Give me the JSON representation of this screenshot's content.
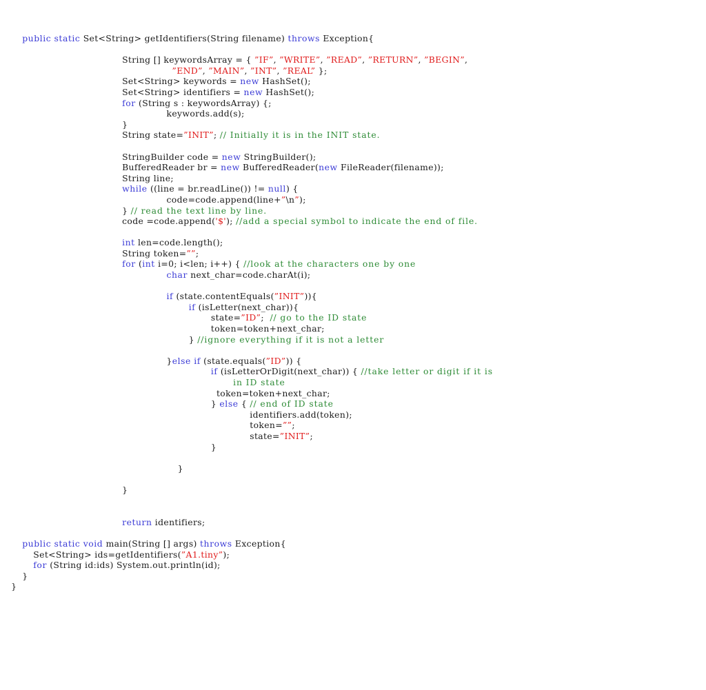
{
  "document": {
    "kind": "code-listing",
    "language": "Java",
    "theme": {
      "background": "#ffffff",
      "plain": "#1a1a1a",
      "keyword": "#3b3bd6",
      "string": "#e01b1b",
      "comment": "#2e8b36"
    }
  },
  "lines": [
    {
      "indent": 4,
      "tokens": [
        {
          "t": "kw",
          "s": "public"
        },
        {
          "t": "pln",
          "s": " "
        },
        {
          "t": "kw",
          "s": "static"
        },
        {
          "t": "pln",
          "s": " Set<String> getIdentifiers(String filename) "
        },
        {
          "t": "kw",
          "s": "throws"
        },
        {
          "t": "pln",
          "s": " Exception{"
        }
      ]
    },
    {
      "indent": 0,
      "tokens": []
    },
    {
      "indent": 22,
      "tokens": [
        {
          "t": "pln",
          "s": "String [] keywordsArray = { "
        },
        {
          "t": "str",
          "s": "”IF”"
        },
        {
          "t": "pln",
          "s": ", "
        },
        {
          "t": "str",
          "s": "”WRITE”"
        },
        {
          "t": "pln",
          "s": ", "
        },
        {
          "t": "str",
          "s": "”READ”"
        },
        {
          "t": "pln",
          "s": ", "
        },
        {
          "t": "str",
          "s": "”RETURN”"
        },
        {
          "t": "pln",
          "s": ", "
        },
        {
          "t": "str",
          "s": "”BEGIN”"
        },
        {
          "t": "pln",
          "s": ","
        }
      ]
    },
    {
      "indent": 31,
      "tokens": [
        {
          "t": "str",
          "s": "”END”"
        },
        {
          "t": "pln",
          "s": ", "
        },
        {
          "t": "str",
          "s": "”MAIN”"
        },
        {
          "t": "pln",
          "s": ", "
        },
        {
          "t": "str",
          "s": "”INT”"
        },
        {
          "t": "pln",
          "s": ", "
        },
        {
          "t": "str",
          "s": "”REAL”"
        },
        {
          "t": "pln",
          "s": " };"
        }
      ]
    },
    {
      "indent": 22,
      "tokens": [
        {
          "t": "pln",
          "s": "Set<String> keywords = "
        },
        {
          "t": "kw",
          "s": "new"
        },
        {
          "t": "pln",
          "s": " HashSet();"
        }
      ]
    },
    {
      "indent": 22,
      "tokens": [
        {
          "t": "pln",
          "s": "Set<String> identifiers = "
        },
        {
          "t": "kw",
          "s": "new"
        },
        {
          "t": "pln",
          "s": " HashSet();"
        }
      ]
    },
    {
      "indent": 22,
      "tokens": [
        {
          "t": "kw",
          "s": "for"
        },
        {
          "t": "pln",
          "s": " (String s : keywordsArray) {;"
        }
      ]
    },
    {
      "indent": 30,
      "tokens": [
        {
          "t": "pln",
          "s": "keywords.add(s);"
        }
      ]
    },
    {
      "indent": 22,
      "tokens": [
        {
          "t": "pln",
          "s": "}"
        }
      ]
    },
    {
      "indent": 22,
      "tokens": [
        {
          "t": "pln",
          "s": "String state="
        },
        {
          "t": "str",
          "s": "”INIT”"
        },
        {
          "t": "pln",
          "s": "; "
        },
        {
          "t": "cmt",
          "s": "// Initially it is in the INIT state."
        }
      ]
    },
    {
      "indent": 0,
      "tokens": []
    },
    {
      "indent": 22,
      "tokens": [
        {
          "t": "pln",
          "s": "StringBuilder code = "
        },
        {
          "t": "kw",
          "s": "new"
        },
        {
          "t": "pln",
          "s": " StringBuilder();"
        }
      ]
    },
    {
      "indent": 22,
      "tokens": [
        {
          "t": "pln",
          "s": "BufferedReader br = "
        },
        {
          "t": "kw",
          "s": "new"
        },
        {
          "t": "pln",
          "s": " BufferedReader("
        },
        {
          "t": "kw",
          "s": "new"
        },
        {
          "t": "pln",
          "s": " FileReader(filename));"
        }
      ]
    },
    {
      "indent": 22,
      "tokens": [
        {
          "t": "pln",
          "s": "String line;"
        }
      ]
    },
    {
      "indent": 22,
      "tokens": [
        {
          "t": "kw",
          "s": "while"
        },
        {
          "t": "pln",
          "s": " ((line = br.readLine()) != "
        },
        {
          "t": "kw",
          "s": "null"
        },
        {
          "t": "pln",
          "s": ") {"
        }
      ]
    },
    {
      "indent": 30,
      "tokens": [
        {
          "t": "pln",
          "s": "code=code.append(line+"
        },
        {
          "t": "str",
          "s": "”"
        },
        {
          "t": "pln",
          "s": "\\n"
        },
        {
          "t": "str",
          "s": "”"
        },
        {
          "t": "pln",
          "s": ");"
        }
      ]
    },
    {
      "indent": 22,
      "tokens": [
        {
          "t": "pln",
          "s": "} "
        },
        {
          "t": "cmt",
          "s": "// read the text line by line."
        }
      ]
    },
    {
      "indent": 22,
      "tokens": [
        {
          "t": "pln",
          "s": "code =code.append("
        },
        {
          "t": "str",
          "s": "'$'"
        },
        {
          "t": "pln",
          "s": "); "
        },
        {
          "t": "cmt",
          "s": "//add a special symbol to indicate the end of file."
        }
      ]
    },
    {
      "indent": 0,
      "tokens": []
    },
    {
      "indent": 22,
      "tokens": [
        {
          "t": "kw",
          "s": "int"
        },
        {
          "t": "pln",
          "s": " len=code.length();"
        }
      ]
    },
    {
      "indent": 22,
      "tokens": [
        {
          "t": "pln",
          "s": "String token="
        },
        {
          "t": "str",
          "s": "””"
        },
        {
          "t": "pln",
          "s": ";"
        }
      ]
    },
    {
      "indent": 22,
      "tokens": [
        {
          "t": "kw",
          "s": "for"
        },
        {
          "t": "pln",
          "s": " ("
        },
        {
          "t": "kw",
          "s": "int"
        },
        {
          "t": "pln",
          "s": " i=0; i<len; i++) { "
        },
        {
          "t": "cmt",
          "s": "//look at the characters one by one"
        }
      ]
    },
    {
      "indent": 30,
      "tokens": [
        {
          "t": "kw",
          "s": "char"
        },
        {
          "t": "pln",
          "s": " next_char=code.charAt(i);"
        }
      ]
    },
    {
      "indent": 0,
      "tokens": []
    },
    {
      "indent": 30,
      "tokens": [
        {
          "t": "kw",
          "s": "if"
        },
        {
          "t": "pln",
          "s": " (state.contentEquals("
        },
        {
          "t": "str",
          "s": "”INIT”"
        },
        {
          "t": "pln",
          "s": ")){"
        }
      ]
    },
    {
      "indent": 34,
      "tokens": [
        {
          "t": "kw",
          "s": "if"
        },
        {
          "t": "pln",
          "s": " (isLetter(next_char)){"
        }
      ]
    },
    {
      "indent": 38,
      "tokens": [
        {
          "t": "pln",
          "s": "state="
        },
        {
          "t": "str",
          "s": "”ID”"
        },
        {
          "t": "pln",
          "s": ";  "
        },
        {
          "t": "cmt",
          "s": "// go to the ID state"
        }
      ]
    },
    {
      "indent": 38,
      "tokens": [
        {
          "t": "pln",
          "s": "token=token+next_char;"
        }
      ]
    },
    {
      "indent": 34,
      "tokens": [
        {
          "t": "pln",
          "s": "} "
        },
        {
          "t": "cmt",
          "s": "//ignore everything if it is not a letter"
        }
      ]
    },
    {
      "indent": 0,
      "tokens": []
    },
    {
      "indent": 30,
      "tokens": [
        {
          "t": "pln",
          "s": "}"
        },
        {
          "t": "kw",
          "s": "else"
        },
        {
          "t": "pln",
          "s": " "
        },
        {
          "t": "kw",
          "s": "if"
        },
        {
          "t": "pln",
          "s": " (state.equals("
        },
        {
          "t": "str",
          "s": "”ID”"
        },
        {
          "t": "pln",
          "s": ")) {"
        }
      ]
    },
    {
      "indent": 38,
      "tokens": [
        {
          "t": "kw",
          "s": "if"
        },
        {
          "t": "pln",
          "s": " (isLetterOrDigit(next_char)) { "
        },
        {
          "t": "cmt",
          "s": "//take letter or digit if it is"
        }
      ]
    },
    {
      "indent": 42,
      "tokens": [
        {
          "t": "cmt",
          "s": "in ID state"
        }
      ]
    },
    {
      "indent": 39,
      "tokens": [
        {
          "t": "pln",
          "s": "token=token+next_char;"
        }
      ]
    },
    {
      "indent": 38,
      "tokens": [
        {
          "t": "pln",
          "s": "} "
        },
        {
          "t": "kw",
          "s": "else"
        },
        {
          "t": "pln",
          "s": " { "
        },
        {
          "t": "cmt",
          "s": "// end of ID state"
        }
      ]
    },
    {
      "indent": 45,
      "tokens": [
        {
          "t": "pln",
          "s": "identifiers.add(token);"
        }
      ]
    },
    {
      "indent": 45,
      "tokens": [
        {
          "t": "pln",
          "s": "token="
        },
        {
          "t": "str",
          "s": "””"
        },
        {
          "t": "pln",
          "s": ";"
        }
      ]
    },
    {
      "indent": 45,
      "tokens": [
        {
          "t": "pln",
          "s": "state="
        },
        {
          "t": "str",
          "s": "”INIT”"
        },
        {
          "t": "pln",
          "s": ";"
        }
      ]
    },
    {
      "indent": 38,
      "tokens": [
        {
          "t": "pln",
          "s": "}"
        }
      ]
    },
    {
      "indent": 0,
      "tokens": []
    },
    {
      "indent": 32,
      "tokens": [
        {
          "t": "pln",
          "s": "}"
        }
      ]
    },
    {
      "indent": 0,
      "tokens": []
    },
    {
      "indent": 22,
      "tokens": [
        {
          "t": "pln",
          "s": "}"
        }
      ]
    },
    {
      "indent": 0,
      "tokens": []
    },
    {
      "indent": 0,
      "tokens": []
    },
    {
      "indent": 22,
      "tokens": [
        {
          "t": "kw",
          "s": "return"
        },
        {
          "t": "pln",
          "s": " identifiers;"
        }
      ]
    },
    {
      "indent": 0,
      "tokens": []
    },
    {
      "indent": 4,
      "tokens": [
        {
          "t": "kw",
          "s": "public"
        },
        {
          "t": "pln",
          "s": " "
        },
        {
          "t": "kw",
          "s": "static"
        },
        {
          "t": "pln",
          "s": " "
        },
        {
          "t": "kw",
          "s": "void"
        },
        {
          "t": "pln",
          "s": " main(String [] args) "
        },
        {
          "t": "kw",
          "s": "throws"
        },
        {
          "t": "pln",
          "s": " Exception{"
        }
      ]
    },
    {
      "indent": 6,
      "tokens": [
        {
          "t": "pln",
          "s": "Set<String> ids=getIdentifiers("
        },
        {
          "t": "str",
          "s": "”A1.tiny”"
        },
        {
          "t": "pln",
          "s": ");"
        }
      ]
    },
    {
      "indent": 6,
      "tokens": [
        {
          "t": "kw",
          "s": "for"
        },
        {
          "t": "pln",
          "s": " (String id:ids) System.out.println(id);"
        }
      ]
    },
    {
      "indent": 4,
      "tokens": [
        {
          "t": "pln",
          "s": "}"
        }
      ]
    },
    {
      "indent": 2,
      "tokens": [
        {
          "t": "pln",
          "s": "}"
        }
      ]
    }
  ]
}
